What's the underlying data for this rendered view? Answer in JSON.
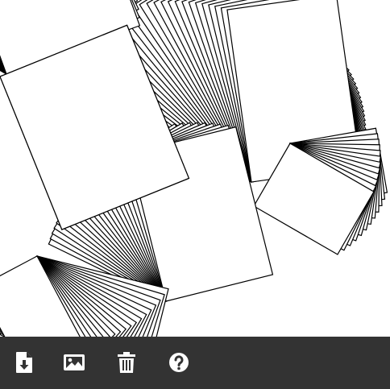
{
  "app": {
    "canvas_background": "#ffffff",
    "stroke_color": "#000000",
    "fill_color": "#ffffff"
  },
  "toolbar": {
    "background": "#333333",
    "icon_color": "#ffffff",
    "buttons": [
      {
        "icon": "file-download-icon",
        "label": ""
      },
      {
        "icon": "image-icon",
        "label": ""
      },
      {
        "icon": "trash-icon",
        "label": ""
      },
      {
        "icon": "help-circle-icon",
        "label": ""
      }
    ]
  }
}
